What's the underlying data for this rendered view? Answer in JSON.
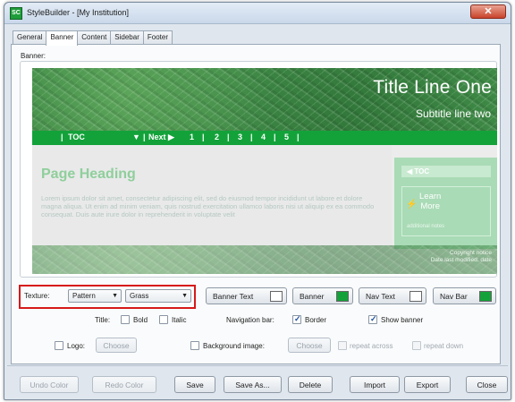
{
  "window": {
    "title": "StyleBuilder - [My Institution]",
    "icon_text": "SC",
    "close_glyph": "✕"
  },
  "tabs": [
    {
      "label": "General"
    },
    {
      "label": "Banner",
      "active": true
    },
    {
      "label": "Content"
    },
    {
      "label": "Sidebar"
    },
    {
      "label": "Footer"
    }
  ],
  "banner_section_label": "Banner:",
  "preview": {
    "title_line_one": "Title Line One",
    "subtitle": "Subtitle line two",
    "nav": {
      "toc": "TOC",
      "toc_arrow": "▼",
      "next": "Next ▶",
      "pages": [
        "1",
        "2",
        "3",
        "4",
        "5"
      ]
    },
    "page_heading": "Page Heading",
    "lorem": "Lorem ipsum dolor sit amet, consectetur adipiscing elit, sed do eiusmod tempor incididunt ut labore et dolore magna aliqua. Ut enim ad minim veniam, quis nostrud exercitation ullamco laboris nisi ut aliquip ex ea commodo consequat. Duis aute irure dolor in reprehenderit in voluptate velit",
    "sidebar": {
      "toc": "◀   TOC",
      "learn": "Learn\nMore",
      "small": "additional notes"
    },
    "footer": {
      "copyright": "Copyright notice\nDate last modified: date"
    }
  },
  "controls": {
    "texture_label": "Texture:",
    "texture_type": "Pattern",
    "texture_pattern": "Grass",
    "banner_text_btn": "Banner Text",
    "banner_btn": "Banner",
    "nav_text_btn": "Nav Text",
    "nav_bar_btn": "Nav Bar",
    "title_label": "Title:",
    "bold_label": "Bold",
    "italic_label": "Italic",
    "navbar_label": "Navigation bar:",
    "border_label": "Border",
    "show_banner_label": "Show banner",
    "logo_label": "Logo:",
    "choose_label": "Choose",
    "bg_image_label": "Background image:",
    "choose2_label": "Choose",
    "repeat_across_label": "repeat across",
    "repeat_down_label": "repeat down"
  },
  "footer_buttons": {
    "undo_color": "Undo Color",
    "redo_color": "Redo Color",
    "save": "Save",
    "save_as": "Save As...",
    "delete": "Delete",
    "import": "Import",
    "export": "Export",
    "close": "Close"
  },
  "colors": {
    "banner_text_swatch": "#ffffff",
    "banner_swatch": "#13a23a",
    "nav_text_swatch": "#ffffff",
    "nav_bar_swatch": "#13a23a",
    "highlight": "#d61a1a"
  }
}
